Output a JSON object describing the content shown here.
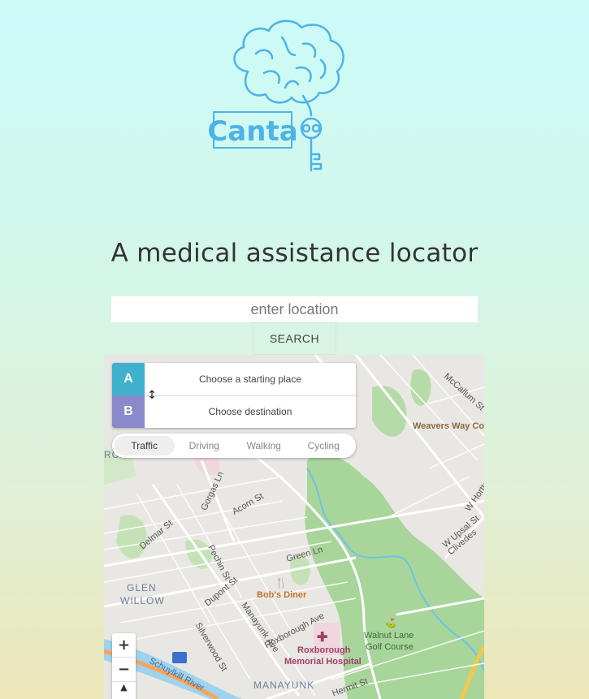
{
  "logo": {
    "text": "Canta"
  },
  "tagline": "A medical assistance locator",
  "search": {
    "placeholder": "enter location",
    "button_label": "SEARCH"
  },
  "directions": {
    "origin_tag": "A",
    "origin_placeholder": "Choose a starting place",
    "destination_tag": "B",
    "destination_placeholder": "Choose destination",
    "swap_icon": "↕",
    "colors": {
      "origin": "#3fb1ce",
      "destination": "#8a8acb"
    }
  },
  "modes": [
    "Traffic",
    "Driving",
    "Walking",
    "Cycling"
  ],
  "active_mode": "Traffic",
  "map": {
    "labels": {
      "mccallum": "McCallum St",
      "weavers": "Weavers Way Co-",
      "w_hortter": "W Hortte",
      "w_upsal": "W Upsal St",
      "cliveden": "Clivedes",
      "gorgas": "Gorgas Ln",
      "acorn": "Acorn St",
      "delmar": "Delmar St",
      "pechin": "Pechin St",
      "green": "Green Ln",
      "glen": "GLEN",
      "willow": "WILLOW",
      "dupont": "Dupont St",
      "bobs": "Bob's Diner",
      "manayunk_ave": "Manayunk Ave",
      "roxborough_ave": "Roxborough Ave",
      "silverwood": "Silverwood St",
      "roxborough_hosp_1": "Roxborough",
      "roxborough_hosp_2": "Memorial Hospital",
      "walnut_1": "Walnut Lane",
      "walnut_2": "Golf Course",
      "manayunk": "MANAYUNK",
      "schuylkill": "Schuylkill River",
      "hermit": "Hermit St",
      "roborough_top": "ROXBOROUGH"
    },
    "zoom_in": "+",
    "zoom_out": "−",
    "compass": "▲"
  }
}
